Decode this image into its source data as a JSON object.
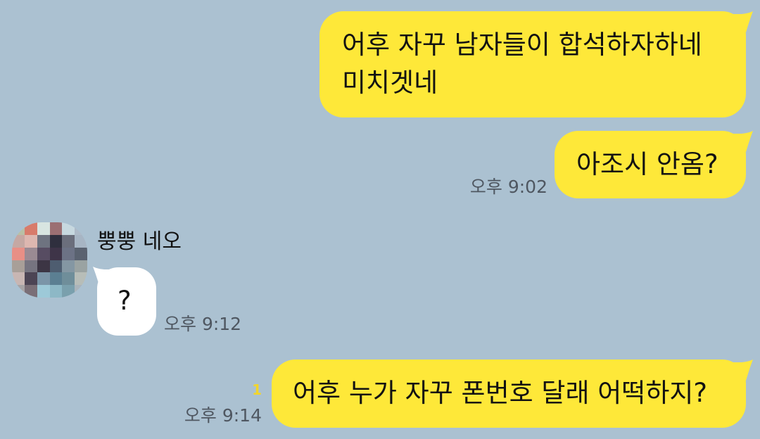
{
  "theme": {
    "background": "#abc1d1",
    "my_bubble": "#fee839",
    "their_bubble": "#ffffff",
    "timestamp_color": "#4f5761",
    "unread_color": "#f2d52c"
  },
  "messages": [
    {
      "from": "me",
      "lines": [
        "어후 자꾸 남자들이 합석하자하네",
        "미치겟네"
      ]
    },
    {
      "from": "me",
      "lines": [
        "아조시 안옴?"
      ],
      "time": "오후 9:02"
    },
    {
      "from": "other",
      "sender": "뿡뿡 네오",
      "avatar_icon": "pixelated-avatar-icon",
      "lines": [
        "?"
      ],
      "time": "오후 9:12"
    },
    {
      "from": "me",
      "lines": [
        "어후 누가 자꾸 폰번호 달래 어떡하지?"
      ],
      "time": "오후 9:14",
      "unread_count": "1"
    }
  ]
}
